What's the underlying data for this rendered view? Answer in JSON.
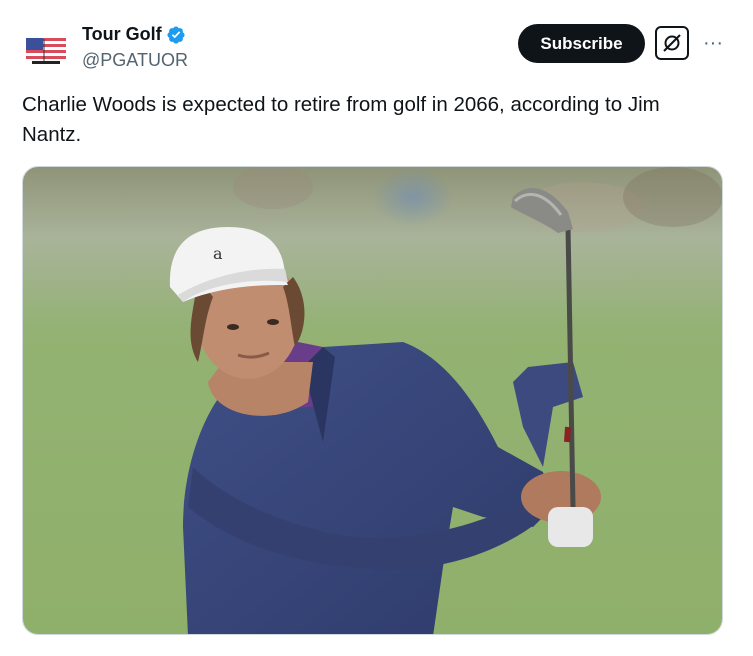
{
  "post": {
    "author": {
      "display_name": "Tour Golf",
      "handle": "@PGATUOR",
      "verified": true,
      "avatar_icon": "flag-avatar-icon"
    },
    "actions": {
      "subscribe_label": "Subscribe",
      "grok_icon": "grok-icon",
      "more_label": "···"
    },
    "text": "Charlie Woods is expected to retire from golf in 2066, according to Jim Nantz.",
    "media": {
      "alt": "Photo of a young golfer in a white cap and navy quarter-zip following through on a swing",
      "cap_logo": "a"
    }
  },
  "colors": {
    "text_primary": "#0f1419",
    "text_secondary": "#536471",
    "verified_blue": "#1d9bf0",
    "button_dark": "#0f1419",
    "border": "#cfd9de"
  }
}
